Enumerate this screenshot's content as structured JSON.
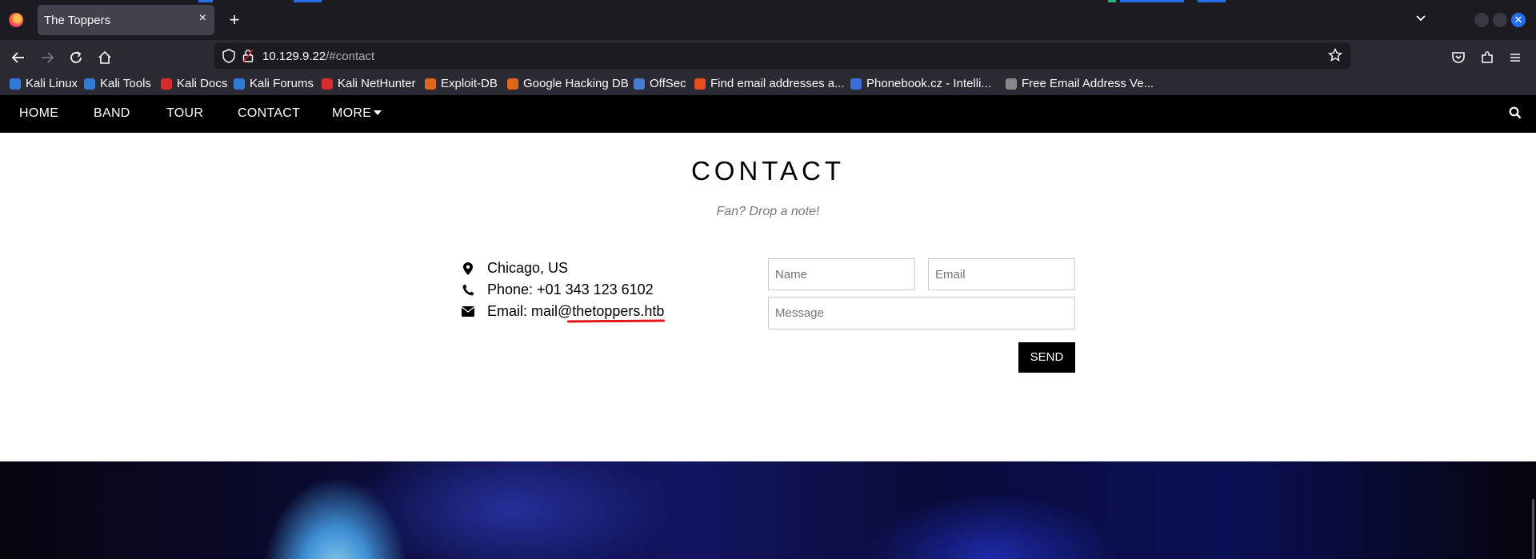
{
  "browser": {
    "tab_title": "The Toppers",
    "tab_close": "×",
    "new_tab": "+",
    "url_host": "10.129.9.22",
    "url_path": "/#contact",
    "window_buttons": [
      "minimize",
      "maximize",
      "close"
    ]
  },
  "bookmarks": [
    {
      "label": "Kali Linux",
      "color": "#2f7bd6"
    },
    {
      "label": "Kali Tools",
      "color": "#2f7bd6"
    },
    {
      "label": "Kali Docs",
      "color": "#d62c2c"
    },
    {
      "label": "Kali Forums",
      "color": "#2f7bd6"
    },
    {
      "label": "Kali NetHunter",
      "color": "#d62c2c"
    },
    {
      "label": "Exploit-DB",
      "color": "#e0661b"
    },
    {
      "label": "Google Hacking DB",
      "color": "#e0661b"
    },
    {
      "label": "OffSec",
      "color": "#4a7bd1"
    },
    {
      "label": "Find email addresses a...",
      "color": "#e5501e"
    },
    {
      "label": "Phonebook.cz - Intelli...",
      "color": "#3b6fd6"
    },
    {
      "label": "Free Email Address Ve...",
      "color": "#888888"
    }
  ],
  "site_nav": {
    "items": [
      "HOME",
      "BAND",
      "TOUR",
      "CONTACT",
      "MORE"
    ]
  },
  "contact": {
    "title": "CONTACT",
    "subtitle": "Fan? Drop a note!",
    "location": "Chicago, US",
    "phone": "Phone: +01 343 123 6102",
    "email_prefix": "Email: mail@",
    "email_domain": "thetoppers.htb",
    "form": {
      "name_placeholder": "Name",
      "email_placeholder": "Email",
      "message_placeholder": "Message",
      "send_label": "SEND"
    }
  },
  "colors": {
    "accent_underline": "#e0161b",
    "nav_bg": "#000000",
    "browser_bg": "#1c1b22"
  }
}
